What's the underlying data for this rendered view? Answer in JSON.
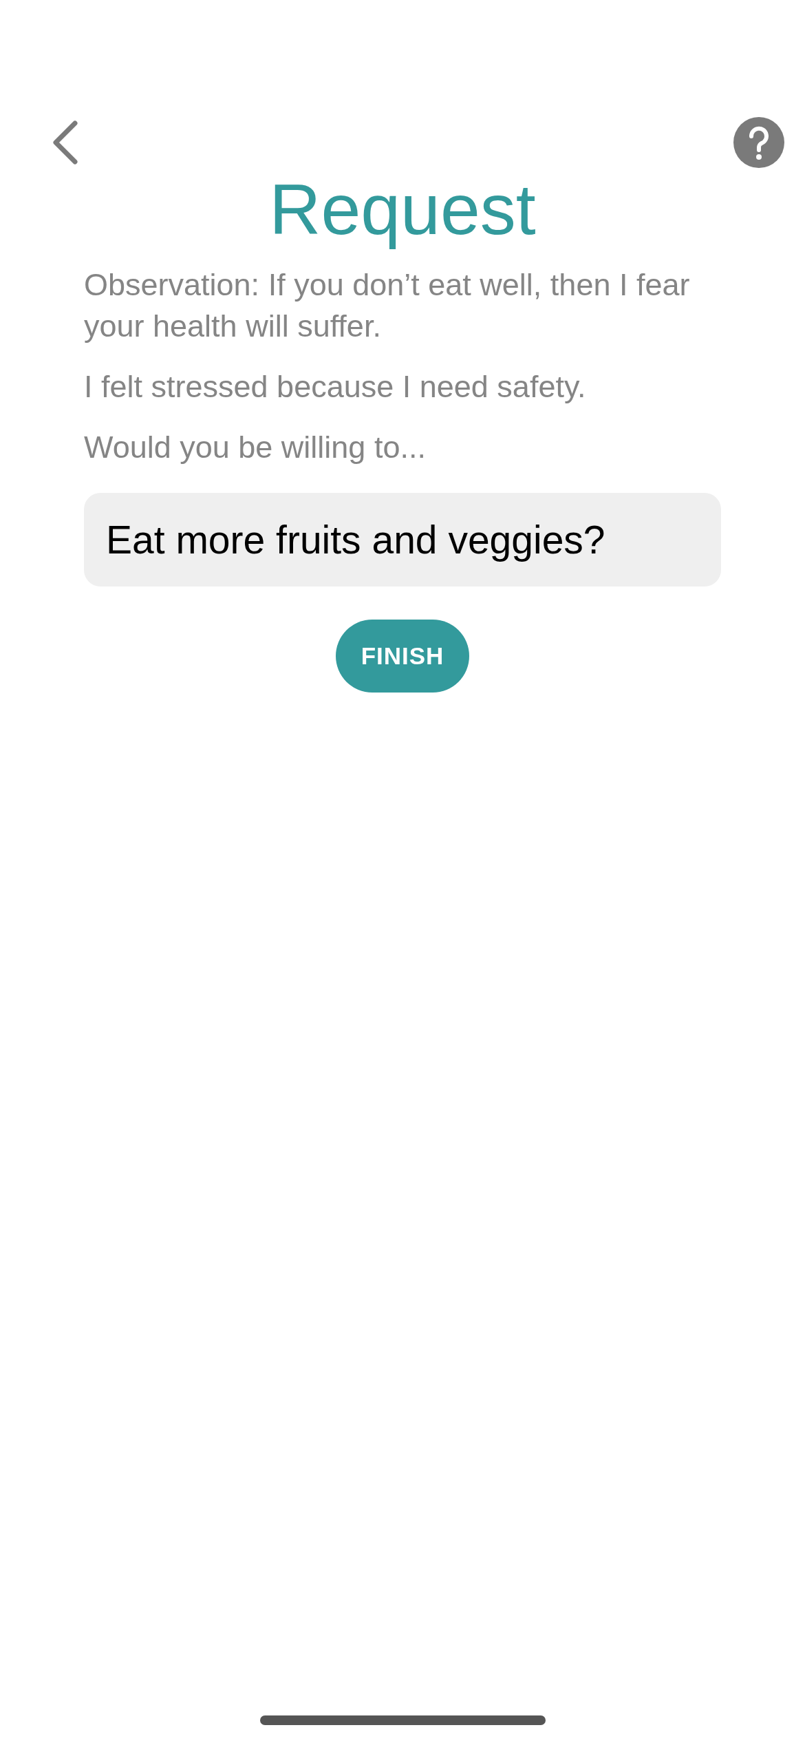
{
  "header": {
    "title": "Request"
  },
  "paragraphs": [
    "Observation: If you don’t eat well, then I fear your health will suffer.",
    "I felt stressed because I need safety.",
    "Would you be willing to..."
  ],
  "request_field": {
    "value": "Eat more fruits and veggies?"
  },
  "finish_button": {
    "label": "FINISH"
  }
}
